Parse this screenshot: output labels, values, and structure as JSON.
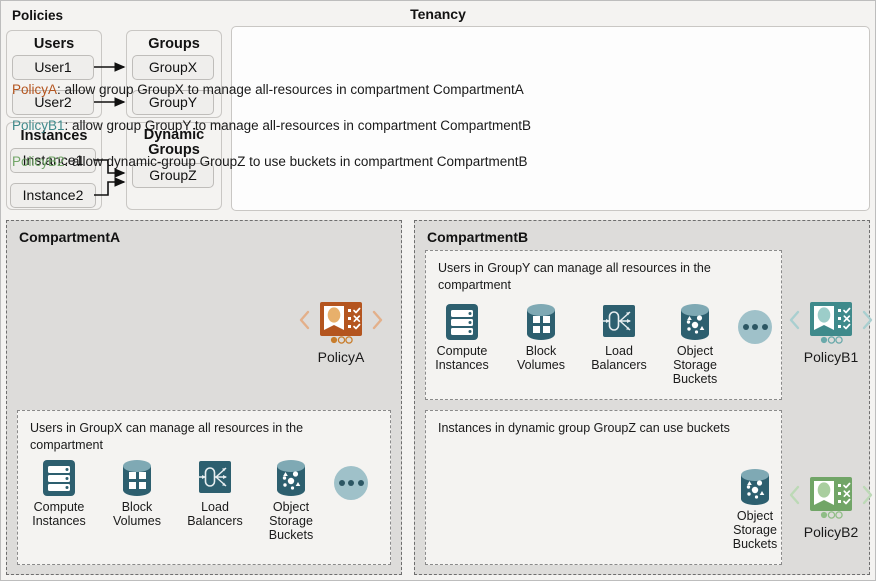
{
  "tenancy": {
    "title": "Tenancy"
  },
  "identity": {
    "users_box": {
      "title": "Users",
      "items": [
        "User1",
        "User2"
      ]
    },
    "groups_box": {
      "title": "Groups",
      "items": [
        "GroupX",
        "GroupY"
      ]
    },
    "instances_box": {
      "title": "Instances",
      "items": [
        "Instance1",
        "Instance2"
      ]
    },
    "dynamic_groups_box": {
      "title": "Dynamic Groups",
      "title_line1": "Dynamic",
      "title_line2": "Groups",
      "items": [
        "GroupZ"
      ]
    }
  },
  "policies_panel": {
    "heading": "Policies",
    "lines": [
      {
        "name": "PolicyA",
        "color": "#b4551f",
        "text": ": allow group GroupX to manage all-resources in compartment CompartmentA"
      },
      {
        "name": "PolicyB1",
        "color": "#3f8a8b",
        "text": ": allow group GroupY to manage all-resources in compartment CompartmentB"
      },
      {
        "name": "PolicyB2",
        "color": "#71a567",
        "text": ": allow dynamic-group GroupZ to use buckets in compartment CompartmentB"
      }
    ]
  },
  "compartment_a": {
    "title": "CompartmentA",
    "policy_badge": {
      "label": "PolicyA",
      "color": "#b4551f",
      "icon": "policy-card-icon"
    },
    "statement": {
      "text": "Users in GroupX can manage all resources in the compartment",
      "resources": [
        {
          "label_line1": "Compute",
          "label_line2": "Instances",
          "label_line3": "",
          "icon": "compute-instances-icon"
        },
        {
          "label_line1": "Block",
          "label_line2": "Volumes",
          "label_line3": "",
          "icon": "block-volumes-icon"
        },
        {
          "label_line1": "Load",
          "label_line2": "Balancers",
          "label_line3": "",
          "icon": "load-balancers-icon"
        },
        {
          "label_line1": "Object",
          "label_line2": "Storage",
          "label_line3": "Buckets",
          "icon": "object-storage-buckets-icon"
        }
      ],
      "more_indicator": "more-resources-icon"
    }
  },
  "compartment_b": {
    "title": "CompartmentB",
    "statement1": {
      "text": "Users in GroupY can manage all resources in the compartment",
      "resources": [
        {
          "label_line1": "Compute",
          "label_line2": "Instances",
          "label_line3": "",
          "icon": "compute-instances-icon"
        },
        {
          "label_line1": "Block",
          "label_line2": "Volumes",
          "label_line3": "",
          "icon": "block-volumes-icon"
        },
        {
          "label_line1": "Load",
          "label_line2": "Balancers",
          "label_line3": "",
          "icon": "load-balancers-icon"
        },
        {
          "label_line1": "Object",
          "label_line2": "Storage",
          "label_line3": "Buckets",
          "icon": "object-storage-buckets-icon"
        }
      ],
      "more_indicator": "more-resources-icon",
      "policy_badge": {
        "label": "PolicyB1",
        "color": "#3f8a8b",
        "icon": "policy-card-icon"
      }
    },
    "statement2": {
      "text": "Instances in dynamic group GroupZ can use buckets",
      "resources": [
        {
          "label_line1": "Object",
          "label_line2": "Storage",
          "label_line3": "Buckets",
          "icon": "object-storage-buckets-icon"
        }
      ],
      "policy_badge": {
        "label": "PolicyB2",
        "color": "#71a567",
        "icon": "policy-card-icon"
      }
    }
  },
  "colors": {
    "teal_icon": "#2d5f6f",
    "teal_icon_light": "#7fa9b4",
    "policy_a": "#b4551f",
    "policy_b1": "#3f8a8b",
    "policy_b2": "#71a567",
    "compartment_bg": "#dddcda",
    "tenancy_bg": "#f4f3f1"
  }
}
